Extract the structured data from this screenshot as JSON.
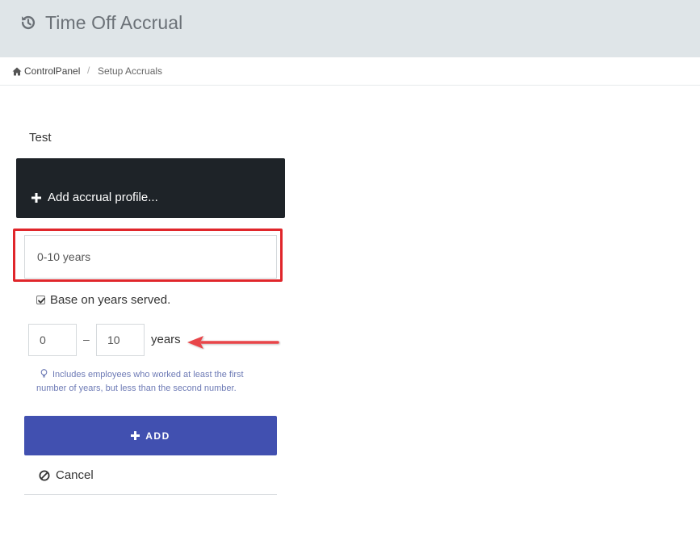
{
  "header": {
    "title": "Time Off Accrual",
    "icon": "history-clock-icon"
  },
  "breadcrumb": {
    "home_label": "ControlPanel",
    "separator": "/",
    "current": "Setup Accruals"
  },
  "form": {
    "profile_name": "Test",
    "add_profile_label": "Add accrual profile...",
    "profile_input_value": "0-10 years",
    "base_on_years_checked": true,
    "base_on_years_label": "Base on years served.",
    "years_from": "0",
    "years_dash": "–",
    "years_to": "10",
    "years_unit": "years",
    "hint": "Includes employees who worked at least the first number of years, but less than the second number.",
    "add_button_label": "ADD",
    "cancel_label": "Cancel"
  },
  "colors": {
    "header_bg": "#dfe5e8",
    "dark_bar": "#1e2328",
    "primary": "#4150b0",
    "highlight": "#e0262b",
    "annotation_arrow": "#e84548",
    "hint_text": "#6d7ab5"
  }
}
